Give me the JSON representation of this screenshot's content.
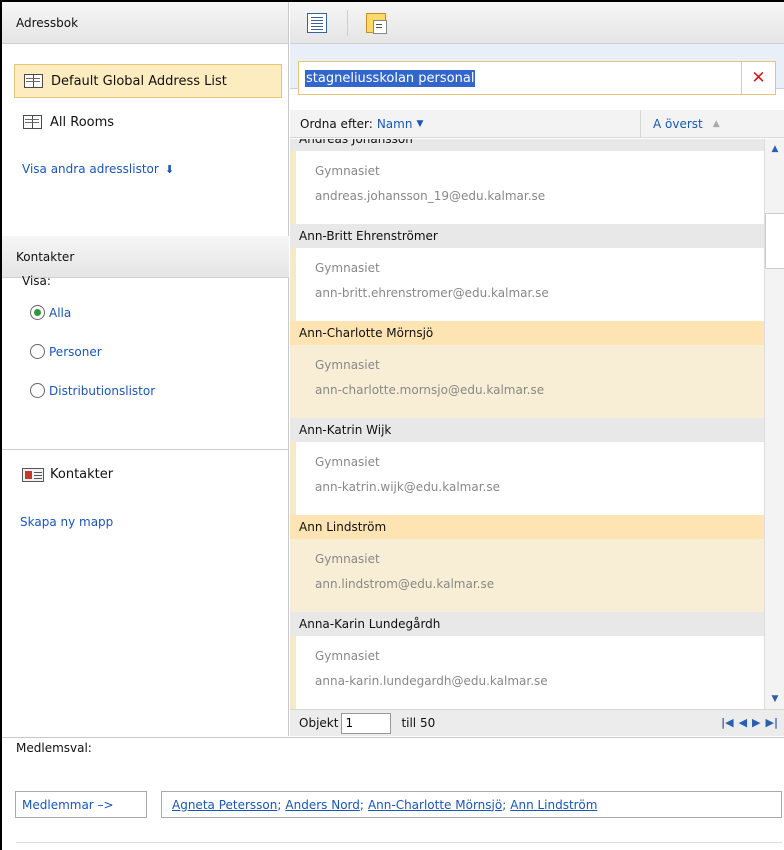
{
  "left": {
    "addressbook_header": "Adressbok",
    "address_lists": [
      {
        "label": "Default Global Address List",
        "selected": true
      },
      {
        "label": "All Rooms",
        "selected": false
      }
    ],
    "show_other_lists": "Visa andra adresslistor",
    "contacts_header": "Kontakter",
    "show_label": "Visa:",
    "filters": [
      {
        "label": "Alla",
        "checked": true
      },
      {
        "label": "Personer",
        "checked": false
      },
      {
        "label": "Distributionslistor",
        "checked": false
      }
    ],
    "contacts_folder": "Kontakter",
    "create_folder": "Skapa ny mapp"
  },
  "search": {
    "value": "stagneliusskolan personal",
    "clear_icon": "close-icon"
  },
  "sort": {
    "label": "Ordna efter:",
    "field": "Namn",
    "order": "A överst"
  },
  "entries": [
    {
      "name": "Andreas Johansson",
      "department": "Gymnasiet",
      "email": "andreas.johansson_19@edu.kalmar.se",
      "selected": false
    },
    {
      "name": "Ann-Britt Ehrenströmer",
      "department": "Gymnasiet",
      "email": "ann-britt.ehrenstromer@edu.kalmar.se",
      "selected": false
    },
    {
      "name": "Ann-Charlotte Mörnsjö",
      "department": "Gymnasiet",
      "email": "ann-charlotte.mornsjo@edu.kalmar.se",
      "selected": true
    },
    {
      "name": "Ann-Katrin Wijk",
      "department": "Gymnasiet",
      "email": "ann-katrin.wijk@edu.kalmar.se",
      "selected": false
    },
    {
      "name": "Ann Lindström",
      "department": "Gymnasiet",
      "email": "ann.lindstrom@edu.kalmar.se",
      "selected": true
    },
    {
      "name": "Anna-Karin Lundegårdh",
      "department": "Gymnasiet",
      "email": "anna-karin.lundegardh@edu.kalmar.se",
      "selected": false
    }
  ],
  "footer": {
    "object_label": "Objekt",
    "object_value": "1",
    "till_label": "till 50"
  },
  "bottom": {
    "member_selection_label": "Medlemsval:",
    "members_button": "Medlemmar –>",
    "members": [
      "Agneta Petersson",
      "Anders Nord",
      "Ann-Charlotte Mörnsjö",
      "Ann Lindström"
    ],
    "separator": ";"
  },
  "colors": {
    "link": "#1a56b5",
    "selection": "#fde4b2",
    "accent_border": "#e8c477"
  }
}
